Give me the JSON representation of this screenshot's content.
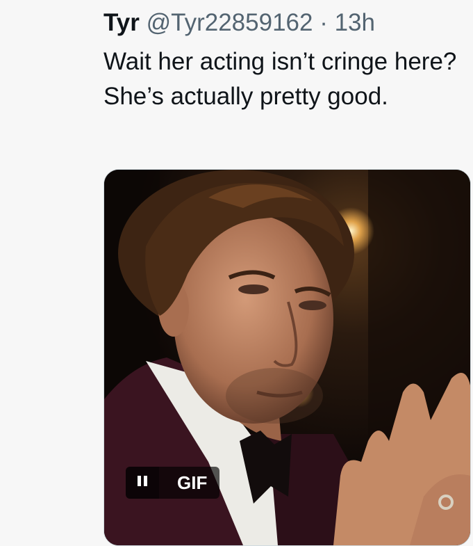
{
  "tweet": {
    "author_name": "Tyr",
    "author_handle": "@Tyr22859162",
    "separator": " · ",
    "timestamp": "13h",
    "text": "Wait her acting isn’t cringe here? She’s actually pretty good.",
    "media": {
      "type": "gif",
      "gif_label": "GIF",
      "pause_icon": "pause-icon",
      "description_colors": {
        "background": "#1a0f0a",
        "suit": "#3a1420",
        "skin": "#b97e5e"
      }
    }
  }
}
